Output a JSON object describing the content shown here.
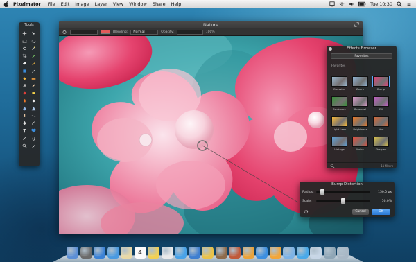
{
  "menubar": {
    "app_name": "Pixelmator",
    "items": [
      "File",
      "Edit",
      "Image",
      "Layer",
      "View",
      "Window",
      "Share",
      "Help"
    ],
    "clock": "Tue 10:30"
  },
  "window": {
    "title": "Nature",
    "toolbar": {
      "blending_label": "Blending:",
      "blending_value": "Normal",
      "opacity_label": "Opacity:",
      "opacity_value": "100%"
    }
  },
  "tools_palette": {
    "title": "Tools"
  },
  "effects_browser": {
    "title": "Effects Browser",
    "dropdown_value": "Favorites",
    "category_label": "Favorites",
    "effects": [
      {
        "label": "Gaussian",
        "color": "#9ab7cf"
      },
      {
        "label": "Zoom",
        "color": "#8fb3d3"
      },
      {
        "label": "Bump",
        "color": "#e0457a"
      },
      {
        "label": "Brickwork",
        "color": "#3a8f3a"
      },
      {
        "label": "Pinwheel",
        "color": "#d89bc9"
      },
      {
        "label": "Fill",
        "color": "#c35fc7"
      },
      {
        "label": "Light Leak",
        "color": "#f6b73a"
      },
      {
        "label": "Brightness",
        "color": "#e87a2a"
      },
      {
        "label": "Hue",
        "color": "#d76a3a"
      },
      {
        "label": "Vintage",
        "color": "#5f9fd4"
      },
      {
        "label": "Noise",
        "color": "#e0503f"
      },
      {
        "label": "Sharpen",
        "color": "#d9c24a"
      }
    ],
    "footer_count": "11 filters"
  },
  "bump_distortion": {
    "title": "Bump Distortion",
    "radius_label": "Radius:",
    "radius_value": "150.0 px",
    "radius_fraction": 0.09,
    "scale_label": "Scale:",
    "scale_value": "50.0%",
    "scale_fraction": 0.5,
    "cancel_label": "Cancel",
    "ok_label": "OK"
  },
  "dock": {
    "colors": [
      "#5c8fd6",
      "#6b6b6b",
      "#3b82d6",
      "#4a9ae0",
      "#e9d9a6",
      "#e04a3a",
      "#f1d054",
      "#eaeaea",
      "#49a3e8",
      "#3f7fd0",
      "#e9c24a",
      "#8e6b4a",
      "#c05a3a",
      "#e9a33a",
      "#3c8fe0",
      "#f2a63a",
      "#7db3e6",
      "#4aa9e8",
      "#c7d6e6",
      "#8fa6b6",
      "#a9b8c6"
    ],
    "calendar_day": "4"
  }
}
